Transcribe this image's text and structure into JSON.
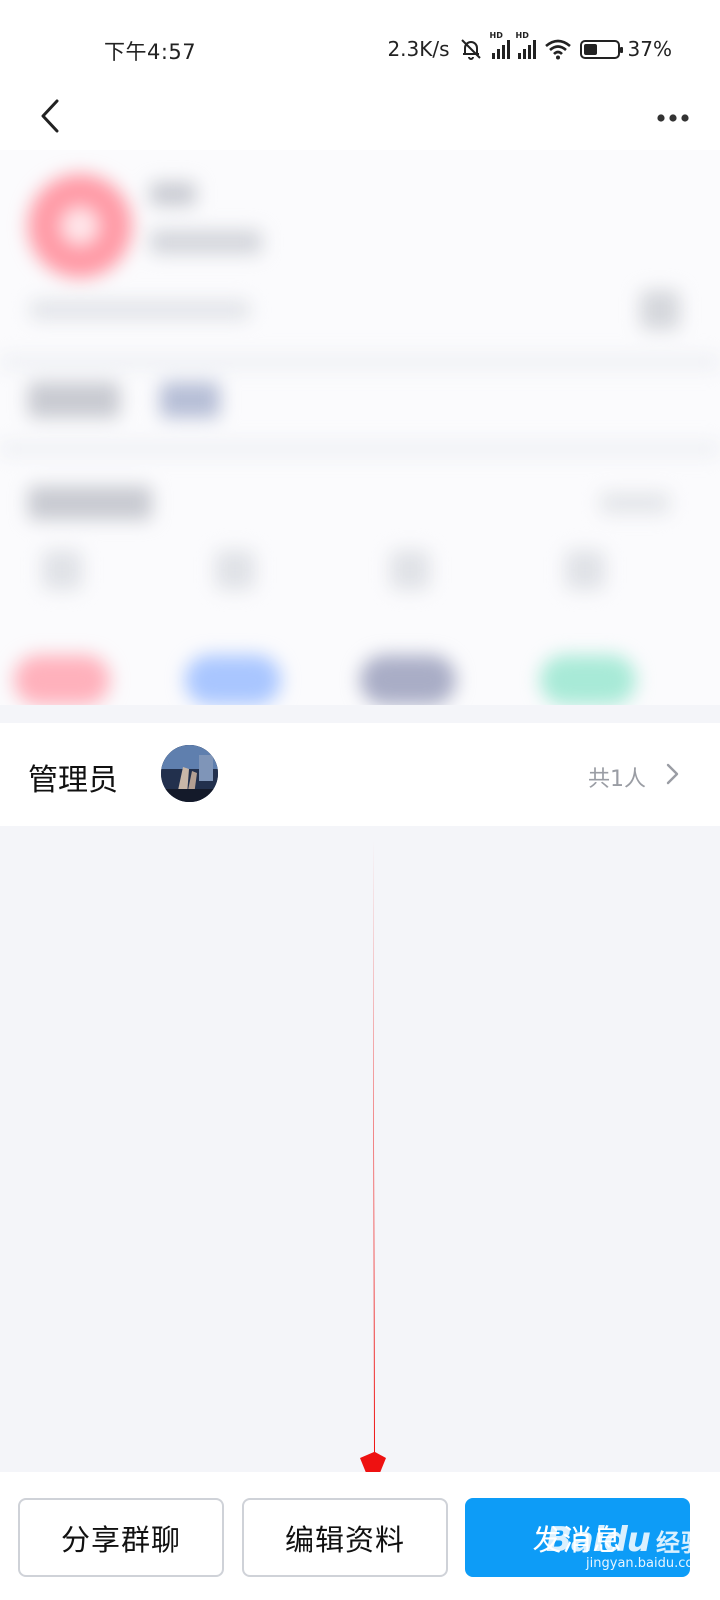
{
  "status_bar": {
    "time": "下午4:57",
    "network_speed": "2.3K/s",
    "battery_percent": "37%",
    "icons": [
      "mute-bell-icon",
      "hd-signal-icon",
      "hd-signal-icon",
      "wifi-icon",
      "battery-icon"
    ]
  },
  "header": {
    "back_icon": "back-arrow-icon",
    "more_icon": "more-dots-icon"
  },
  "admin": {
    "label": "管理员",
    "count": "共1人"
  },
  "actions": {
    "share_label": "分享群聊",
    "edit_label": "编辑资料",
    "message_label": "发消息"
  },
  "watermark": {
    "logo": "Baidu",
    "sub": "经验",
    "url": "jingyan.baidu.com"
  },
  "colors": {
    "primary": "#0d9cf7",
    "page_background": "#f4f5f9",
    "annotation_arrow": "#ee1111"
  }
}
